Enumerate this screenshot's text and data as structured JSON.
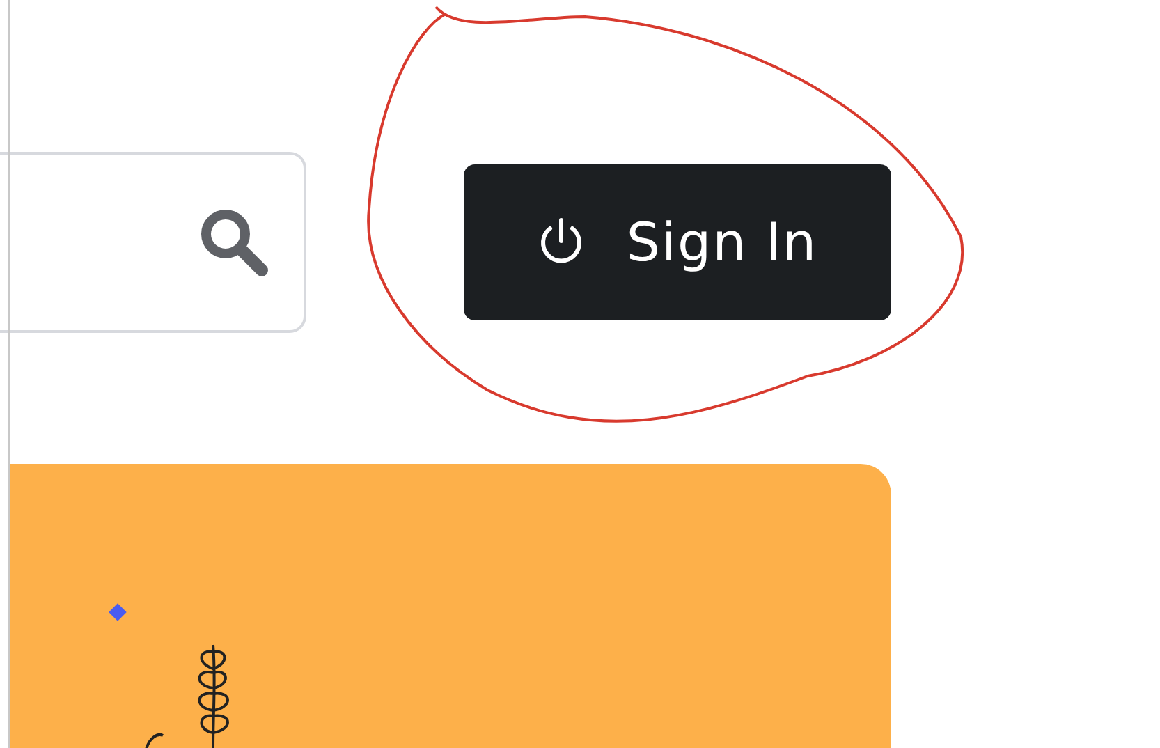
{
  "sign_in_button": {
    "label": "Sign In"
  }
}
